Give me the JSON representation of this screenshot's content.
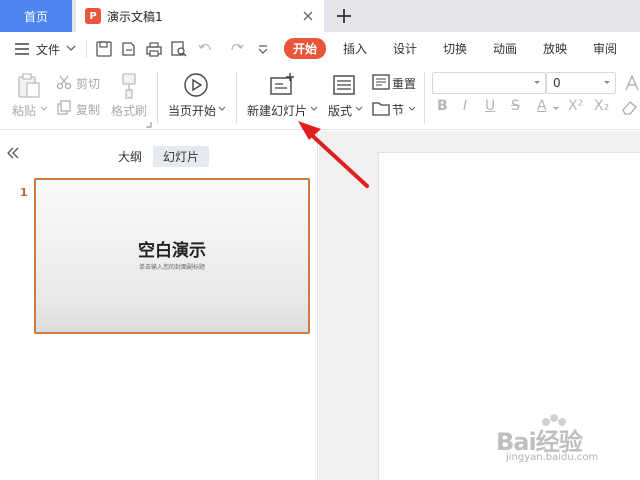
{
  "tabs": {
    "home": "首页",
    "document": "演示文稿1"
  },
  "menu": {
    "file": "文件",
    "ribbon_tabs": [
      "开始",
      "插入",
      "设计",
      "切换",
      "动画",
      "放映",
      "审阅"
    ]
  },
  "ribbon": {
    "paste": "粘贴",
    "cut": "剪切",
    "copy": "复制",
    "format_painter": "格式刷",
    "from_current": "当页开始",
    "new_slide": "新建幻灯片",
    "layout": "版式",
    "reset": "重置",
    "section": "节",
    "font_size": "0"
  },
  "panel": {
    "outline_tab": "大纲",
    "slides_tab": "幻灯片",
    "slide_number": "1",
    "thumb_title": "空白演示",
    "thumb_subtitle": "单击输入您的封面副标题"
  },
  "watermark": {
    "brand": "Bai经验",
    "url": "jingyan.baidu.com"
  },
  "colors": {
    "accent": "#e8553a",
    "home_tab": "#4e86f0",
    "arrow": "#e02020"
  }
}
